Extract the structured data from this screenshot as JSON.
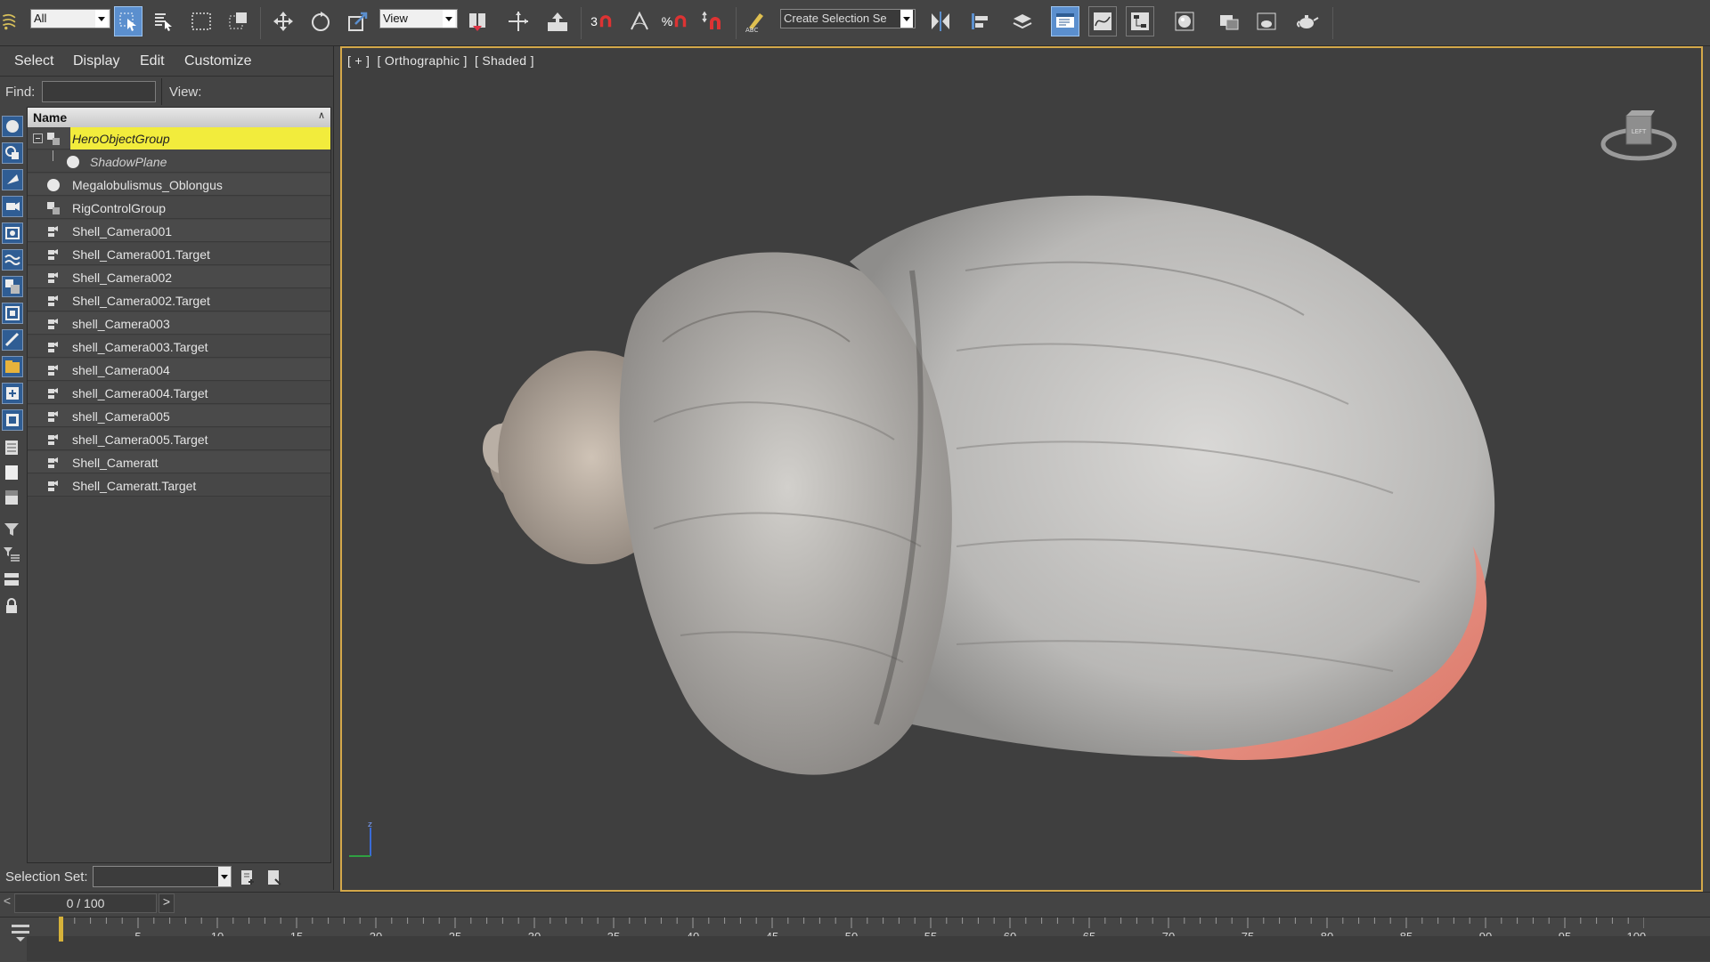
{
  "toolbar": {
    "selection_filter": "All",
    "reference_coordinate": "View",
    "snap_value": "3",
    "angle_snap_label": "%",
    "named_selection_placeholder": "Create Selection Se"
  },
  "explorer": {
    "menu": [
      "Select",
      "Display",
      "Edit",
      "Customize"
    ],
    "find_label": "Find:",
    "view_label": "View:",
    "column_header": "Name",
    "rows": [
      {
        "label": "HeroObjectGroup",
        "type": "group",
        "selected": true
      },
      {
        "label": "ShadowPlane",
        "type": "geometry",
        "child": true
      },
      {
        "label": "Megalobulismus_Oblongus",
        "type": "geometry"
      },
      {
        "label": "RigControlGroup",
        "type": "group"
      },
      {
        "label": "Shell_Camera001",
        "type": "camera"
      },
      {
        "label": "Shell_Camera001.Target",
        "type": "camera"
      },
      {
        "label": "Shell_Camera002",
        "type": "camera"
      },
      {
        "label": "Shell_Camera002.Target",
        "type": "camera"
      },
      {
        "label": "shell_Camera003",
        "type": "camera"
      },
      {
        "label": "shell_Camera003.Target",
        "type": "camera"
      },
      {
        "label": "shell_Camera004",
        "type": "camera"
      },
      {
        "label": "shell_Camera004.Target",
        "type": "camera"
      },
      {
        "label": "shell_Camera005",
        "type": "camera"
      },
      {
        "label": "shell_Camera005.Target",
        "type": "camera"
      },
      {
        "label": "Shell_Cameratt",
        "type": "camera"
      },
      {
        "label": "Shell_Cameratt.Target",
        "type": "camera"
      }
    ],
    "selection_set_label": "Selection Set:"
  },
  "viewport": {
    "labels": [
      "[ + ]",
      "[ Orthographic ]",
      "[ Shaded ]"
    ],
    "viewcube_face": "LEFT",
    "axis_label": "z"
  },
  "timeline": {
    "frame_display": "0 / 100",
    "left_arrow": "<",
    "right_arrow": ">",
    "ticks": [
      "0",
      "5",
      "10",
      "15",
      "20",
      "25",
      "30",
      "35",
      "40",
      "45",
      "50",
      "55",
      "60",
      "65",
      "70",
      "75",
      "80",
      "85",
      "90",
      "95",
      "100"
    ]
  },
  "colors": {
    "selected_row": "#f2ec3c",
    "active_tool": "#5b8fce",
    "viewport_border": "#d4a84a",
    "shell_lip": "#e98b7c"
  }
}
